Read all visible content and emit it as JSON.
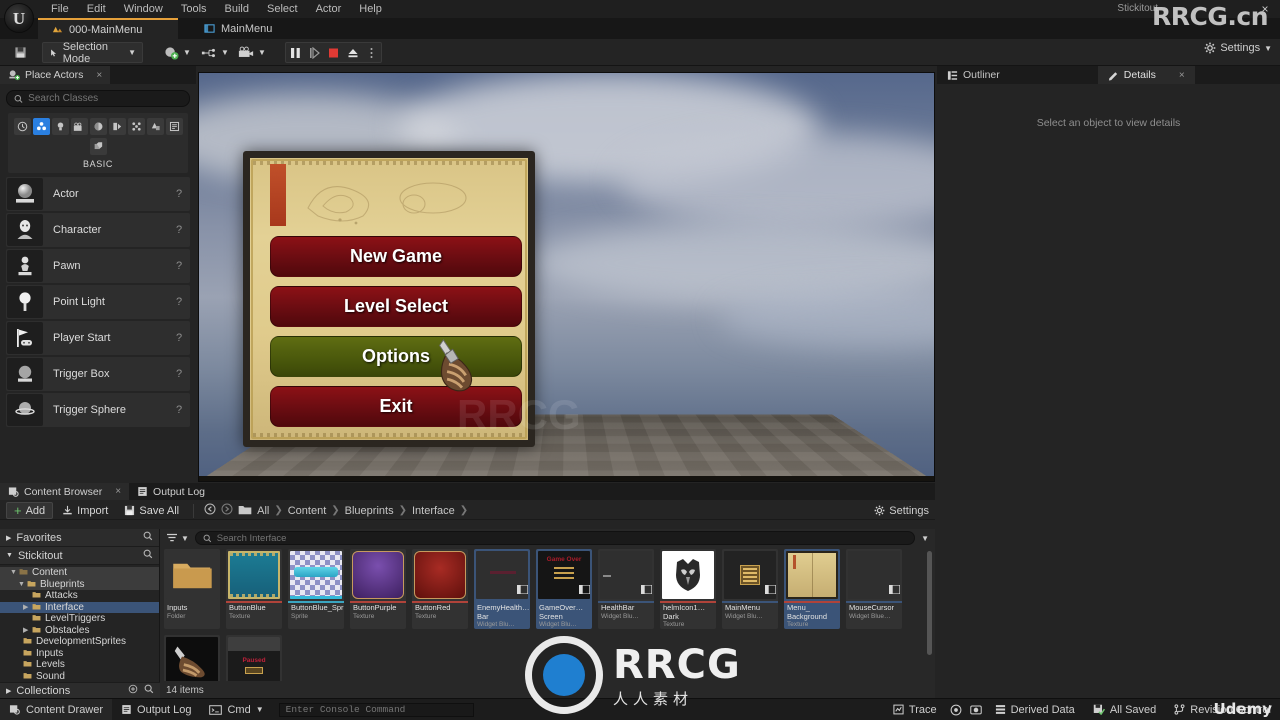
{
  "window": {
    "title": "Stickitout",
    "close_label": "×",
    "watermark": "RRCG.cn",
    "watermark_sub": "人人素材",
    "watermark_brand": "RRCG",
    "udemy": "Udemy"
  },
  "menubar": {
    "items": [
      "File",
      "Edit",
      "Window",
      "Tools",
      "Build",
      "Select",
      "Actor",
      "Help"
    ]
  },
  "tabs": [
    {
      "label": "000-MainMenu",
      "icon": "level-icon",
      "active": true
    },
    {
      "label": "MainMenu",
      "icon": "widget-icon",
      "active": false
    }
  ],
  "toolbar": {
    "save_icon": "save-icon",
    "selection_mode": "Selection Mode",
    "add_label": "add-actor-dropdown",
    "blueprint_label": "blueprints-dropdown",
    "cinematics_label": "cinematics-dropdown",
    "play_controls": [
      "pause-button",
      "frame-step-button",
      "stop-button",
      "eject-button",
      "more-options-button"
    ],
    "settings": "Settings"
  },
  "place_actors": {
    "tab_label": "Place Actors",
    "close": "×",
    "search_placeholder": "Search Classes",
    "category_label": "BASIC",
    "categories": [
      {
        "name": "recently-placed",
        "glyph": "◴",
        "selected": false
      },
      {
        "name": "basic",
        "glyph": "♣",
        "selected": true
      },
      {
        "name": "lights",
        "glyph": "☀",
        "selected": false
      },
      {
        "name": "cinematic",
        "glyph": "Ἲc",
        "selected": false
      },
      {
        "name": "visual-effects",
        "glyph": "◑",
        "selected": false
      },
      {
        "name": "geometry",
        "glyph": "◐",
        "selected": false
      },
      {
        "name": "volumes",
        "glyph": "❖",
        "selected": false
      },
      {
        "name": "all-classes",
        "glyph": "◧",
        "selected": false
      },
      {
        "name": "shapes",
        "glyph": "▣",
        "selected": false
      },
      {
        "name": "extra",
        "glyph": "◫",
        "selected": false
      }
    ],
    "actors": [
      {
        "label": "Actor",
        "icon": "actor-sphere-icon",
        "help": "?"
      },
      {
        "label": "Character",
        "icon": "character-icon",
        "help": "?"
      },
      {
        "label": "Pawn",
        "icon": "pawn-icon",
        "help": "?"
      },
      {
        "label": "Point Light",
        "icon": "point-light-icon",
        "help": "?"
      },
      {
        "label": "Player Start",
        "icon": "player-start-icon",
        "help": "?"
      },
      {
        "label": "Trigger Box",
        "icon": "trigger-box-icon",
        "help": "?"
      },
      {
        "label": "Trigger Sphere",
        "icon": "trigger-sphere-icon",
        "help": "?"
      }
    ]
  },
  "viewport": {
    "game_menu": {
      "buttons": [
        {
          "label": "New Game",
          "style": "red"
        },
        {
          "label": "Level Select",
          "style": "red"
        },
        {
          "label": "Options",
          "style": "green"
        },
        {
          "label": "Exit",
          "style": "red"
        }
      ],
      "cursor": "gauntlet-hand-cursor"
    }
  },
  "right_panel": {
    "tabs": [
      {
        "label": "Outliner",
        "icon": "outliner-icon",
        "active": false,
        "close": ""
      },
      {
        "label": "Details",
        "icon": "details-pencil-icon",
        "active": true,
        "close": "×"
      }
    ],
    "empty_message": "Select an object to view details"
  },
  "content_browser": {
    "tabs": [
      {
        "label": "Content Browser",
        "icon": "content-browser-icon",
        "active": true,
        "close": "×"
      },
      {
        "label": "Output Log",
        "icon": "output-log-icon",
        "active": false,
        "close": ""
      }
    ],
    "buttons": {
      "add": "Add",
      "import": "Import",
      "save_all": "Save All",
      "settings": "Settings"
    },
    "breadcrumb": [
      "All",
      "Content",
      "Blueprints",
      "Interface"
    ],
    "search_placeholder": "Search Interface",
    "tree": {
      "favorites": "Favorites",
      "project": "Stickitout",
      "collections": "Collections",
      "nodes": [
        {
          "label": "Content",
          "depth": 1,
          "expanded": true,
          "selected": false
        },
        {
          "label": "Blueprints",
          "depth": 2,
          "expanded": true,
          "selected": false
        },
        {
          "label": "Attacks",
          "depth": 3,
          "expanded": false,
          "selected": false
        },
        {
          "label": "Interface",
          "depth": 3,
          "expanded": false,
          "selected": true
        },
        {
          "label": "LevelTriggers",
          "depth": 3,
          "expanded": false,
          "selected": false
        },
        {
          "label": "Obstacles",
          "depth": 3,
          "expanded": false,
          "selected": false
        },
        {
          "label": "DevelopmentSprites",
          "depth": 2,
          "expanded": false,
          "selected": false
        },
        {
          "label": "Inputs",
          "depth": 2,
          "expanded": false,
          "selected": false
        },
        {
          "label": "Levels",
          "depth": 2,
          "expanded": false,
          "selected": false
        },
        {
          "label": "Sound",
          "depth": 2,
          "expanded": false,
          "selected": false
        }
      ]
    },
    "item_count": "14 items",
    "assets": [
      {
        "name": "Inputs",
        "type": "Folder",
        "kind": "folder",
        "color": "#d8ab5f",
        "selected": false
      },
      {
        "name": "ButtonBlue",
        "type": "Texture",
        "kind": "texture",
        "color": "#1e7f96",
        "strip": "#b0433a",
        "selected": false
      },
      {
        "name": "ButtonBlue_Sprite",
        "type": "Sprite",
        "kind": "sprite",
        "color": "#6b6fae",
        "strip": "#3aa5c0",
        "selected": false
      },
      {
        "name": "ButtonPurple",
        "type": "Texture",
        "kind": "texture",
        "color": "#5c3a86",
        "strip": "#b0433a",
        "selected": false
      },
      {
        "name": "ButtonRed",
        "type": "Texture",
        "kind": "texture",
        "color": "#8e2521",
        "strip": "#b0433a",
        "selected": false
      },
      {
        "name": "EnemyHealth… Bar",
        "type": "Widget Blu…",
        "kind": "widget",
        "color": "#2f2f2f",
        "strip": "#3b5478",
        "selected": true
      },
      {
        "name": "GameOver… Screen",
        "type": "Widget Blu…",
        "kind": "widget-gameover",
        "color": "#1a1a1a",
        "strip": "#3b5478",
        "selected": true
      },
      {
        "name": "HealthBar",
        "type": "Widget Blu…",
        "kind": "widget",
        "color": "#2f2f2f",
        "strip": "#3b5478",
        "selected": false
      },
      {
        "name": "helmIcon1… Dark",
        "type": "Texture",
        "kind": "texture-helm",
        "color": "#ffffff",
        "strip": "#b0433a",
        "selected": false
      },
      {
        "name": "MainMenu",
        "type": "Widget Blu…",
        "kind": "widget-mainmenu",
        "color": "#262626",
        "strip": "#3b5478",
        "selected": false
      },
      {
        "name": "Menu_ Background",
        "type": "Texture",
        "kind": "texture-book",
        "color": "#d9c486",
        "strip": "#b0433a",
        "selected": true
      },
      {
        "name": "MouseCursor",
        "type": "Widget Blue…",
        "kind": "widget",
        "color": "#2f2f2f",
        "strip": "#3b5478",
        "selected": false
      },
      {
        "name": "",
        "type": "",
        "kind": "texture-cursor",
        "color": "#0d0d0d",
        "strip": "#b0433a",
        "selected": false
      },
      {
        "name": "",
        "type": "",
        "kind": "widget-paused",
        "color": "#3a3a3a",
        "strip": "#3b5478",
        "selected": false
      }
    ]
  },
  "statusbar": {
    "content_drawer": "Content Drawer",
    "output_log": "Output Log",
    "cmd": "Cmd",
    "console_placeholder": "Enter Console Command",
    "trace": "Trace",
    "derived_data": "Derived Data",
    "all_saved": "All Saved",
    "revision_control": "Revision Control"
  }
}
